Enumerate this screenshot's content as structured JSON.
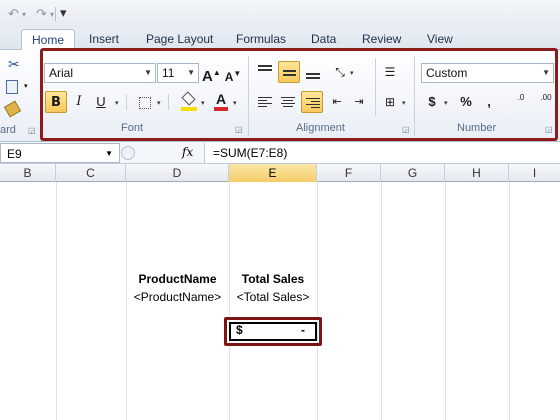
{
  "quick_access": {
    "undo_glyph": "↶",
    "redo_glyph": "↷",
    "customize_glyph": "▾"
  },
  "tabs": [
    {
      "label": "Home"
    },
    {
      "label": "Insert"
    },
    {
      "label": "Page Layout"
    },
    {
      "label": "Formulas"
    },
    {
      "label": "Data"
    },
    {
      "label": "Review"
    },
    {
      "label": "View"
    }
  ],
  "ribbon": {
    "clipboard": {
      "group_label": "ard"
    },
    "font": {
      "group_label": "Font",
      "font_name": "Arial",
      "font_size": "11",
      "grow_label": "A",
      "shrink_label": "A",
      "bold_label": "B",
      "italic_label": "I",
      "underline_label": "U",
      "color_label": "A"
    },
    "alignment": {
      "group_label": "Alignment"
    },
    "number": {
      "group_label": "Number",
      "format": "Custom",
      "currency_label": "$",
      "percent_label": "%",
      "comma_label": ",",
      "inc_decimal_label": ".00",
      "dec_decimal_label": ".0"
    }
  },
  "formula_bar": {
    "name_box": "E9",
    "fx_label": "fx",
    "formula": "=SUM(E7:E8)"
  },
  "columns": [
    "B",
    "C",
    "D",
    "E",
    "F",
    "G",
    "H",
    "I"
  ],
  "selected_column": "E",
  "cells": {
    "d_header": "ProductName",
    "e_header": "Total Sales",
    "d_value": "<ProductName>",
    "e_value": "<Total Sales>",
    "e9_currency": "$",
    "e9_value": "-"
  },
  "colors": {
    "highlight_border": "#8c1c1c",
    "selected_cell_border": "#7d1515",
    "active_button": "#f8c95c",
    "font_color_bar": "#d42a2a",
    "fill_color_bar": "#f5e000"
  }
}
